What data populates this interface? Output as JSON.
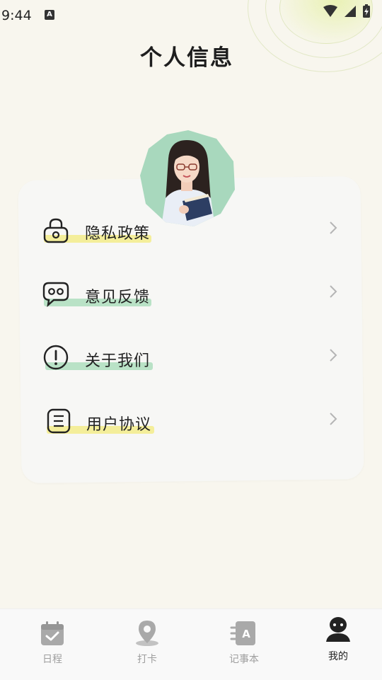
{
  "status_bar": {
    "time": "9:44",
    "indicator": "A"
  },
  "header": {
    "title": "个人信息"
  },
  "menu": {
    "items": [
      {
        "label": "隐私政策",
        "icon": "lock-icon",
        "accent": "#f4ee9a"
      },
      {
        "label": "意见反馈",
        "icon": "chat-bubble-icon",
        "accent": "#b9e2c6"
      },
      {
        "label": "关于我们",
        "icon": "info-alert-icon",
        "accent": "#b9e2c6"
      },
      {
        "label": "用户协议",
        "icon": "document-list-icon",
        "accent": "#f4ee9a"
      }
    ]
  },
  "tabbar": {
    "tabs": [
      {
        "label": "日程",
        "icon": "calendar-check-icon",
        "active": false
      },
      {
        "label": "打卡",
        "icon": "location-pin-icon",
        "active": false
      },
      {
        "label": "记事本",
        "icon": "notebook-icon",
        "active": false
      },
      {
        "label": "我的",
        "icon": "user-icon",
        "active": true
      }
    ]
  },
  "colors": {
    "background": "#f8f6ee",
    "card": "#f7f7f5",
    "avatar_bg": "#a8d8bd",
    "highlight_yellow": "#f4ee9a",
    "highlight_green": "#b9e2c6",
    "tab_inactive": "#9e9e9e",
    "tab_active": "#222222"
  }
}
